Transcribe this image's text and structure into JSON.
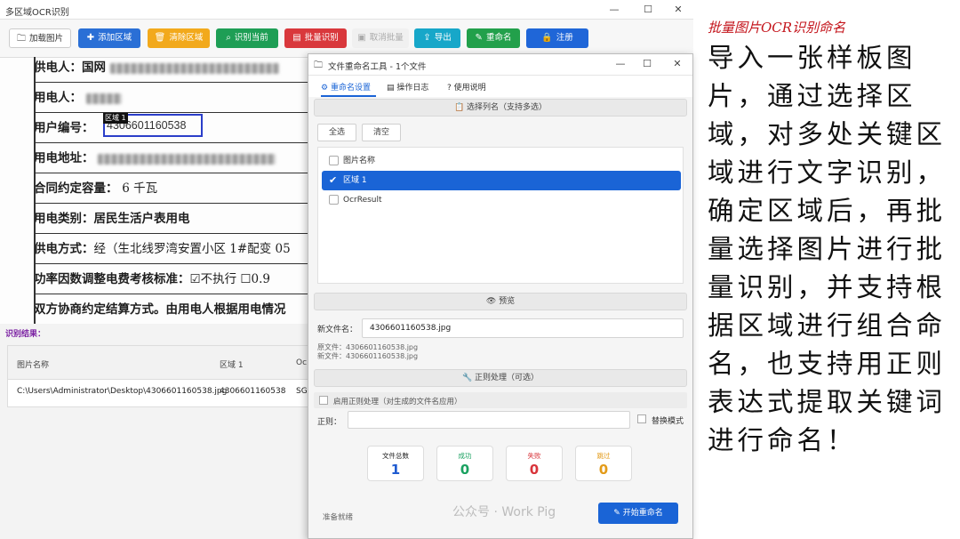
{
  "main_window": {
    "title": "多区域OCR识别",
    "controls": {
      "minimize": "—",
      "maximize": "☐",
      "close": "✕"
    }
  },
  "toolbar": {
    "load_image": "加载图片",
    "add_region": "添加区域",
    "clear_regions": "清除区域",
    "recognize_current": "识别当前",
    "batch_recognize": "批量识别",
    "cancel_batch": "取消批量",
    "export": "导出",
    "rename": "重命名",
    "register": "注册",
    "colors": {
      "blue": "#2a6fd6",
      "yellow": "#f2a91c",
      "green": "#1e9e55",
      "red": "#d9383c",
      "cyan": "#17a7c9",
      "darkgreen": "#22a04b",
      "navy": "#1f66d8"
    }
  },
  "document": {
    "rows": [
      {
        "label": "供电人：",
        "value": "国网"
      },
      {
        "label": "用电人：",
        "value": ""
      },
      {
        "label": "用户编号：",
        "value": ""
      },
      {
        "label": "用电地址：",
        "value": ""
      },
      {
        "label": "合同约定容量：",
        "value": "6 千瓦"
      },
      {
        "label": "用电类别：",
        "value": "居民生活户表用电"
      },
      {
        "label": "供电方式：",
        "value": "经（生北线罗湾安置小区 1#配变 05"
      },
      {
        "label": "功率因数调整电费考核标准：",
        "value": "☑不执行 ☐0.9"
      },
      {
        "label": "双方协商约定结算方式。由用电人根据用电情况",
        "value": ""
      }
    ],
    "region": {
      "tag": "区域 1",
      "text": "4306601160538"
    }
  },
  "results": {
    "label": "识别结果：",
    "columns": [
      "图片名称",
      "区域 1",
      "Oc"
    ],
    "rows": [
      [
        "C:\\Users\\Administrator\\Desktop\\4306601160538.jpg",
        "4306601160538",
        "SG"
      ]
    ]
  },
  "dialog": {
    "title": "文件重命名工具 - 1个文件",
    "tabs": [
      "重命名设置",
      "操作日志",
      "使用说明"
    ],
    "select_columns": "选择列名（支持多选）",
    "select_all": "全选",
    "clear": "清空",
    "columns": [
      "图片名称",
      "区域 1",
      "OcrResult"
    ],
    "selected_index": 1,
    "preview_header": "预览",
    "new_name_label": "新文件名：",
    "new_name_value": "4306601160538.jpg",
    "orig_file": "原文件：4306601160538.jpg",
    "new_file": "新文件：4306601160538.jpg",
    "regex_header": "正则处理（可选）",
    "enable_regex": "启用正则处理（对生成的文件名应用）",
    "regex_label": "正则：",
    "replace_mode": "替换模式",
    "stats": [
      {
        "label": "文件总数",
        "value": "1",
        "color": "#1f5bd0"
      },
      {
        "label": "成功",
        "value": "0",
        "color": "#1aa160"
      },
      {
        "label": "失败",
        "value": "0",
        "color": "#d8343a"
      },
      {
        "label": "跳过",
        "value": "0",
        "color": "#e39b19"
      }
    ],
    "status": "准备就绪",
    "rename_button": "开始重命名",
    "watermark": "公众号 · Work Pig"
  },
  "side_note": {
    "title": "批量图片OCR识别命名",
    "text": "导入一张样板图片，通过选择区域，对多处关键区域进行文字识别，确定区域后，再批量选择图片进行批量识别，并支持根据区域进行组合命名，也支持用正则表达式提取关键词进行命名！"
  }
}
